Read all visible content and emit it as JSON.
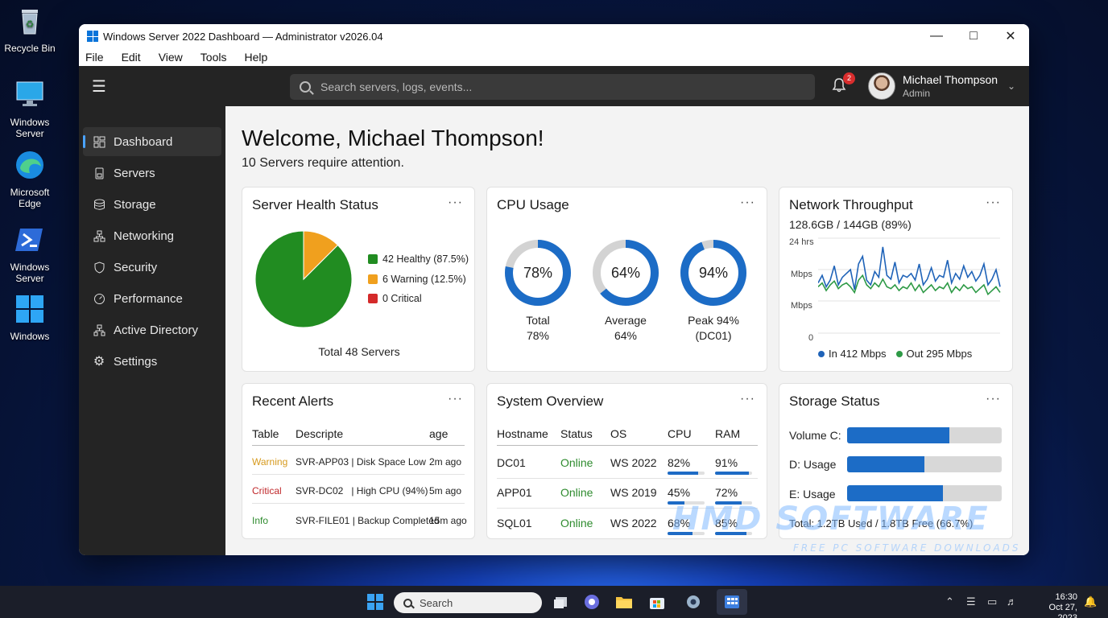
{
  "desktop": {
    "icons": [
      {
        "label": "Recycle Bin"
      },
      {
        "label": "Windows Server"
      },
      {
        "label": "Microsoft Edge"
      },
      {
        "label": "Windows Server"
      },
      {
        "label": "Windows"
      }
    ]
  },
  "window": {
    "title": "Windows Server 2022 Dashboard — Administrator v2026.04",
    "menu": [
      "File",
      "Edit",
      "View",
      "Tools",
      "Help"
    ]
  },
  "header": {
    "search_placeholder": "Search servers, logs, events...",
    "notification_count": "2",
    "user_name": "Michael Thompson",
    "user_role": "Admin"
  },
  "sidebar": {
    "items": [
      {
        "label": "Dashboard",
        "icon": "dashboard-icon",
        "active": true
      },
      {
        "label": "Servers",
        "icon": "server-icon"
      },
      {
        "label": "Storage",
        "icon": "database-icon"
      },
      {
        "label": "Networking",
        "icon": "network-icon"
      },
      {
        "label": "Security",
        "icon": "shield-icon"
      },
      {
        "label": "Performance",
        "icon": "gauge-icon"
      },
      {
        "label": "Active Directory",
        "icon": "directory-icon"
      },
      {
        "label": "Settings",
        "icon": "gear-icon"
      }
    ]
  },
  "main": {
    "welcome": "Welcome, Michael Thompson!",
    "attention": "10 Servers require attention."
  },
  "health": {
    "title": "Server Health Status",
    "legend": [
      {
        "label": "42 Healthy (87.5%)",
        "color": "#218c21"
      },
      {
        "label": "6 Warning (12.5%)",
        "color": "#f0a01e"
      },
      {
        "label": "0 Critical",
        "color": "#d42a2a"
      }
    ],
    "total": "Total 48 Servers"
  },
  "cpu": {
    "title": "CPU Usage",
    "gauges": [
      {
        "value_text": "78%",
        "caption_1": "Total",
        "caption_2": "78%",
        "fraction": 0.78
      },
      {
        "value_text": "64%",
        "caption_1": "Average",
        "caption_2": "64%",
        "fraction": 0.64
      },
      {
        "value_text": "94%",
        "caption_1": "Peak 94%",
        "caption_2": "(DC01)",
        "fraction": 0.94
      }
    ]
  },
  "network": {
    "title": "Network Throughput",
    "subtitle": "128.6GB / 144GB (89%)",
    "ylabel_top": "24 hrs",
    "ylabel_mid1": "Mbps",
    "ylabel_mid2": "Mbps",
    "ylabel_zero": "0",
    "legend_in": "In 412 Mbps",
    "legend_out": "Out 295 Mbps",
    "in_color": "#1f63b8",
    "out_color": "#2e9a46",
    "in_series": [
      52,
      60,
      48,
      55,
      70,
      50,
      58,
      62,
      66,
      45,
      72,
      80,
      55,
      50,
      64,
      58,
      90,
      60,
      56,
      74,
      52,
      60,
      58,
      62,
      55,
      72,
      50,
      56,
      68,
      54,
      60,
      58,
      76,
      52,
      62,
      56,
      70,
      58,
      64,
      54,
      60,
      72,
      50,
      56,
      66,
      48
    ],
    "out_series": [
      48,
      52,
      44,
      50,
      54,
      46,
      50,
      52,
      48,
      42,
      55,
      60,
      50,
      46,
      52,
      48,
      56,
      48,
      46,
      50,
      44,
      48,
      46,
      52,
      44,
      50,
      42,
      46,
      50,
      44,
      48,
      46,
      52,
      42,
      48,
      44,
      50,
      46,
      48,
      42,
      46,
      50,
      40,
      44,
      48,
      42
    ]
  },
  "alerts": {
    "title": "Recent Alerts",
    "headers": [
      "Table",
      "Descripte",
      "age"
    ],
    "rows": [
      {
        "level": "Warning",
        "color": "#d69a1e",
        "desc": "SVR-APP03 | Disk Space Low",
        "age": "2m ago"
      },
      {
        "level": "Critical",
        "color": "#c0282b",
        "desc": "SVR-DC02   | High CPU (94%)",
        "age": "5m ago"
      },
      {
        "level": "Info",
        "color": "#2e8b2e",
        "desc": "SVR-FILE01 | Backup Completed",
        "age": "15m ago"
      }
    ]
  },
  "overview": {
    "title": "System Overview",
    "headers": [
      "Hostname",
      "Status",
      "OS",
      "CPU",
      "RAM"
    ],
    "rows": [
      {
        "host": "DC01",
        "status": "Online",
        "os": "WS 2022",
        "cpu": "82%",
        "ram": "91%",
        "cpu_f": 0.82,
        "ram_f": 0.91
      },
      {
        "host": "APP01",
        "status": "Online",
        "os": "WS 2019",
        "cpu": "45%",
        "ram": "72%",
        "cpu_f": 0.45,
        "ram_f": 0.72
      },
      {
        "host": "SQL01",
        "status": "Online",
        "os": "WS 2022",
        "cpu": "68%",
        "ram": "85%",
        "cpu_f": 0.68,
        "ram_f": 0.85
      }
    ],
    "status_color": "#2e8b2e"
  },
  "storage": {
    "title": "Storage Status",
    "volumes": [
      {
        "label": "Volume C:",
        "fraction": 0.66
      },
      {
        "label": "D: Usage",
        "fraction": 0.5
      },
      {
        "label": "E: Usage",
        "fraction": 0.62
      }
    ],
    "total": "Total: 1.2TB Used / 1.8TB Free (66.7%)"
  },
  "watermark": {
    "main": "HMD SOFTWARE",
    "sub": "FREE PC SOFTWARE DOWNLOADS"
  },
  "taskbar": {
    "search": "Search",
    "time": "16:30",
    "date": "Oct 27, 2023"
  }
}
